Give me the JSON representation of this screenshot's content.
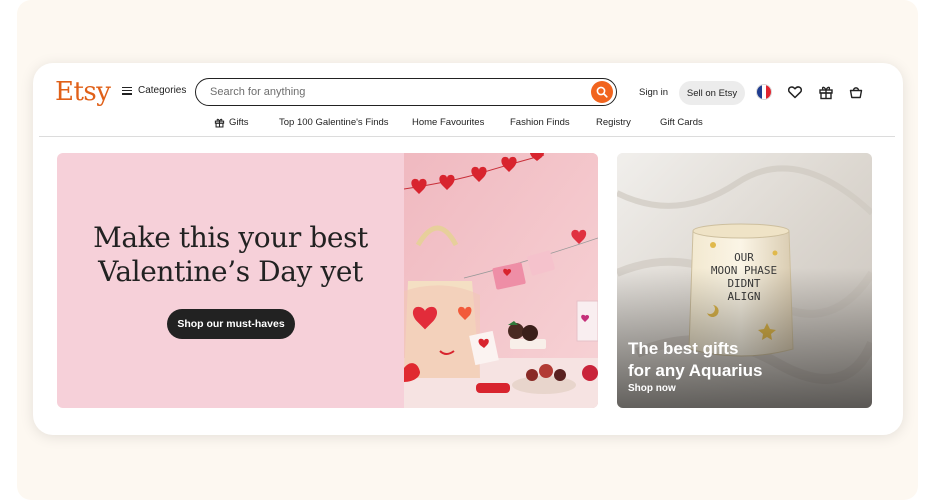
{
  "header": {
    "logo": "Etsy",
    "categories_label": "Categories",
    "search_placeholder": "Search for anything",
    "signin_label": "Sign in",
    "sell_label": "Sell on Etsy"
  },
  "nav": {
    "items": [
      "Gifts",
      "Top 100 Galentine's Finds",
      "Home Favourites",
      "Fashion Finds",
      "Registry",
      "Gift Cards"
    ]
  },
  "hero": {
    "title_line1": "Make this your best",
    "title_line2": "Valentine’s Day yet",
    "button_label": "Shop our must-haves"
  },
  "side_promo": {
    "title_line1": "The best gifts",
    "title_line2": "for any Aquarius",
    "link_label": "Shop now",
    "candle_text": "OUR MOON PHASE DIDNT ALIGN"
  },
  "colors": {
    "brand": "#f1641e",
    "hero_bg": "#f6d0d9",
    "dark_button": "#222222"
  }
}
